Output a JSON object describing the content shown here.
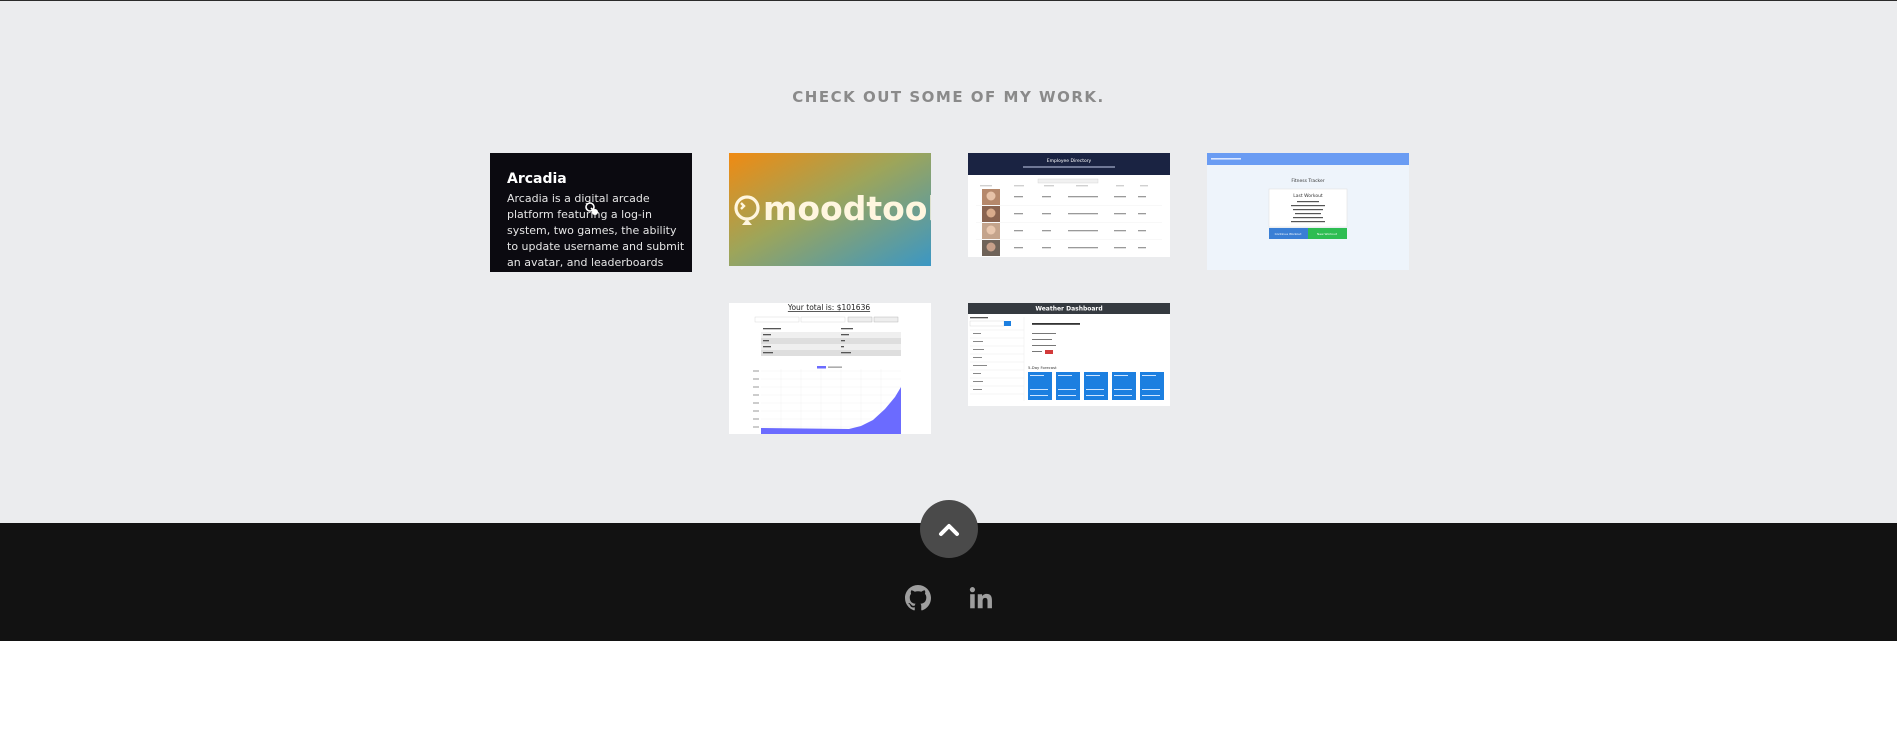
{
  "portfolio": {
    "heading": "CHECK OUT SOME OF MY WORK."
  },
  "projects": [
    {
      "title": "Arcadia",
      "description": "Arcadia is a digital arcade platform featuring a log-in system, two games, the ability to update username and submit an avatar, and leaderboards with"
    },
    {
      "logo_text": "moodtoob",
      "gradient": [
        "#ef8a1a",
        "#3f9cbd"
      ]
    },
    {
      "header_title": "Employee Directory"
    },
    {
      "header_title": "Fitness Tracker",
      "card_title": "Last Workout",
      "button_left": "Continue Workout",
      "button_right": "New Workout"
    },
    {
      "total_label": "Your total is: $101636"
    },
    {
      "header_title": "Weather Dashboard",
      "forecast_label": "5-Day Forecast"
    }
  ],
  "colors": {
    "section_bg": "#ebecee",
    "footer_bg": "#121212",
    "scroll_btn": "#4a4a4a",
    "social_icon": "#9e9e9e"
  },
  "icons": {
    "scroll": "chevron-up-icon",
    "github": "github-icon",
    "linkedin": "linkedin-icon"
  }
}
